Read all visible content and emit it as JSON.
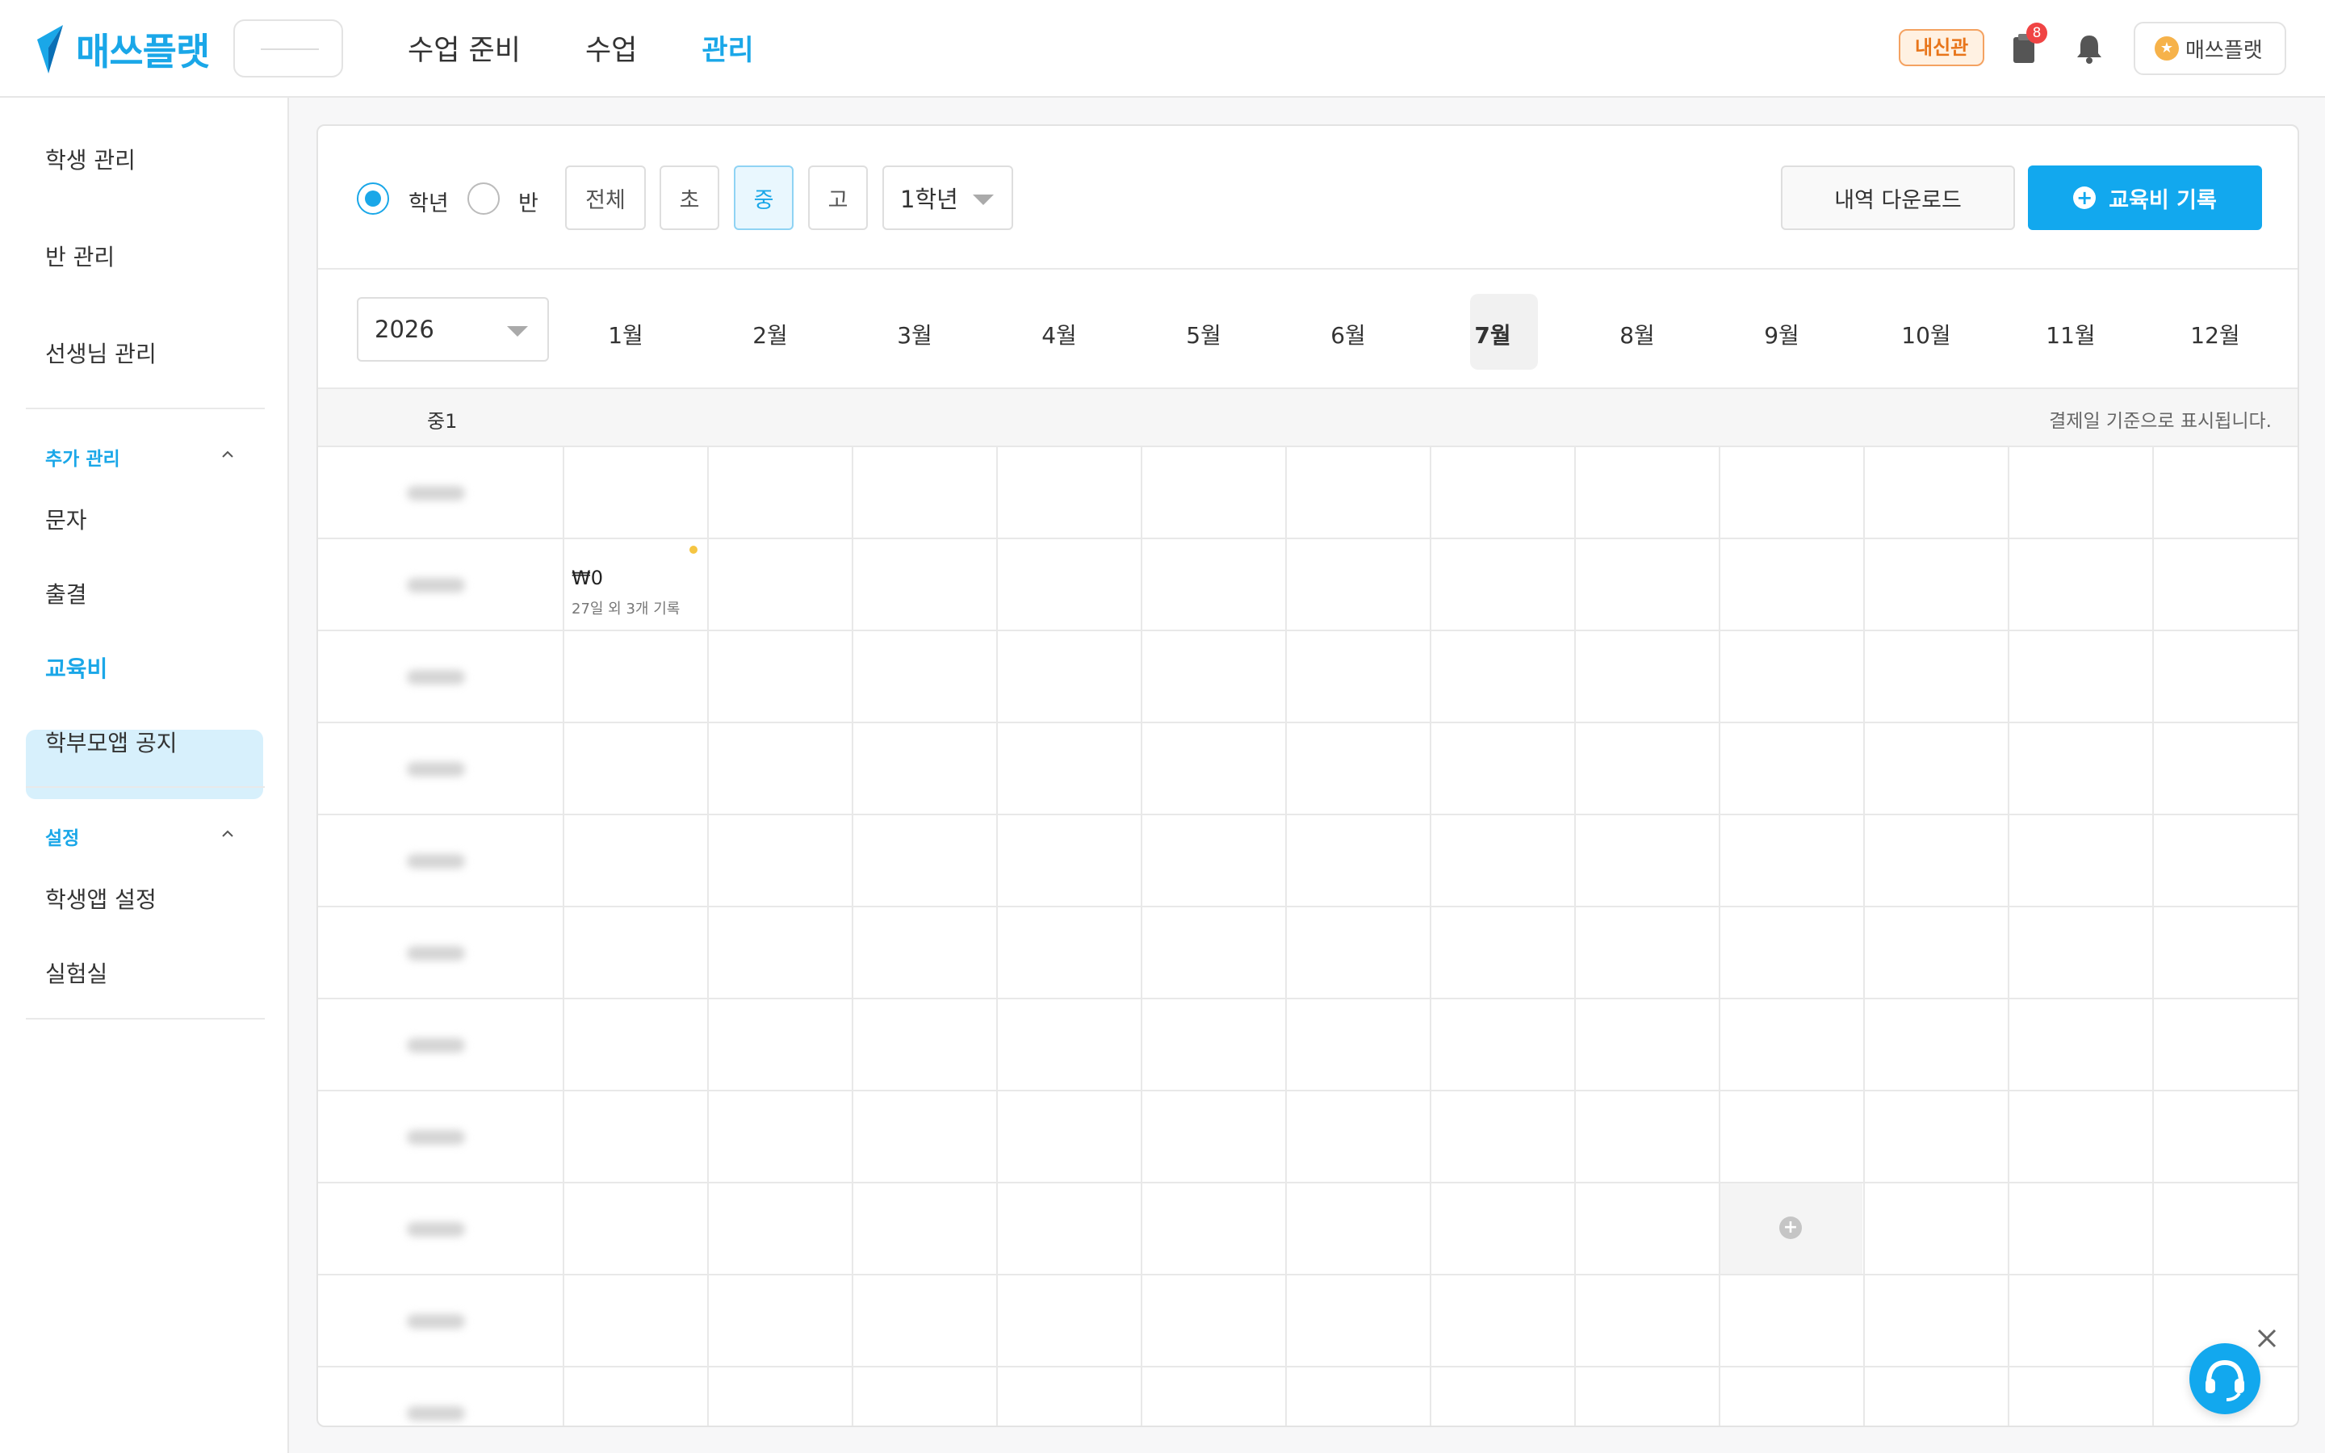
{
  "brand": {
    "name": "매쓰플랫"
  },
  "nav": {
    "items": [
      "수업 준비",
      "수업",
      "관리"
    ],
    "active": "관리"
  },
  "header": {
    "tag": "내신관",
    "notification_badge": "8",
    "profile_name": "매쓰플랫"
  },
  "sidebar": {
    "items_top": [
      "학생 관리",
      "반 관리",
      "선생님 관리"
    ],
    "section_extra": "추가 관리",
    "items_extra": [
      "문자",
      "출결",
      "교육비",
      "학부모앱 공지"
    ],
    "active_item": "교육비",
    "section_settings": "설정",
    "items_settings": [
      "학생앱 설정",
      "실험실"
    ]
  },
  "filters": {
    "radio_grade": "학년",
    "radio_class": "반",
    "segments": [
      "전체",
      "초",
      "중",
      "고"
    ],
    "selected_segment": "중",
    "grade_select": "1학년",
    "download_label": "내역 다운로드",
    "record_label": "교육비 기록"
  },
  "calendar": {
    "year": "2026",
    "months": [
      "1월",
      "2월",
      "3월",
      "4월",
      "5월",
      "6월",
      "7월",
      "8월",
      "9월",
      "10월",
      "11월",
      "12월"
    ],
    "selected_month": "7월"
  },
  "grade_header": {
    "label": "중1",
    "note": "결제일 기준으로 표시됩니다."
  },
  "cell": {
    "amount": "₩0",
    "sub": "27일 외 3개 기록"
  }
}
